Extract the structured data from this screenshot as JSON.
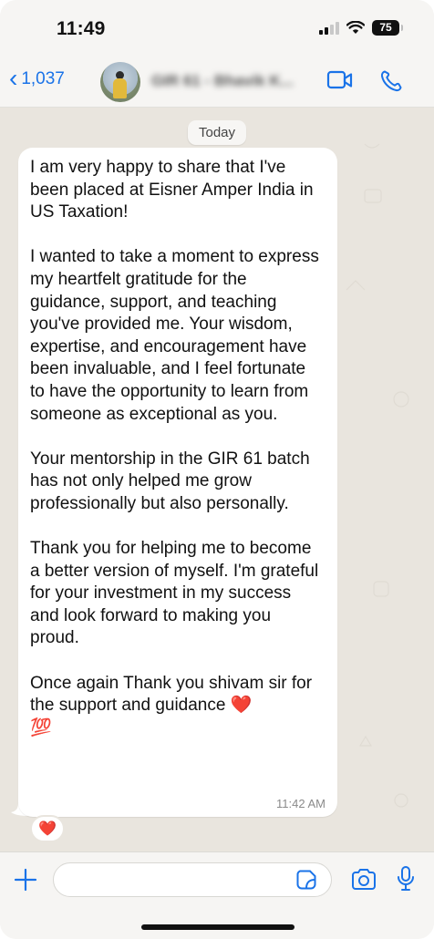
{
  "status_bar": {
    "time": "11:49",
    "battery": "75",
    "icons": [
      "cellular-signal-icon",
      "wifi-icon",
      "battery-icon"
    ]
  },
  "header": {
    "back_count": "1,037",
    "contact_name": "GIR 61 - Bhavik K...",
    "icons": [
      "chevron-left-icon",
      "video-call-icon",
      "phone-call-icon"
    ],
    "accent_color": "#1a73e8"
  },
  "chat": {
    "day_label": "Today",
    "message": {
      "text": "I am very happy to share that I've been placed at Eisner Amper India in US Taxation!\n\nI wanted to take a moment to express my heartfelt gratitude for the guidance, support, and teaching you've provided me. Your wisdom, expertise, and encouragement have been invaluable, and I feel fortunate to have the opportunity to learn from someone as exceptional as you.\n\nYour mentorship in the GIR 61 batch has not only helped me grow professionally but also personally.\n\nThank you for helping me to become a better version of myself. I'm grateful for your investment in my success and look forward to making you proud.\n\nOnce again Thank you shivam sir for the support and guidance ❤️\n💯",
      "time": "11:42 AM",
      "reaction": "❤️"
    }
  },
  "input_bar": {
    "value": "",
    "icons": [
      "plus-icon",
      "sticker-icon",
      "camera-icon",
      "microphone-icon"
    ]
  }
}
